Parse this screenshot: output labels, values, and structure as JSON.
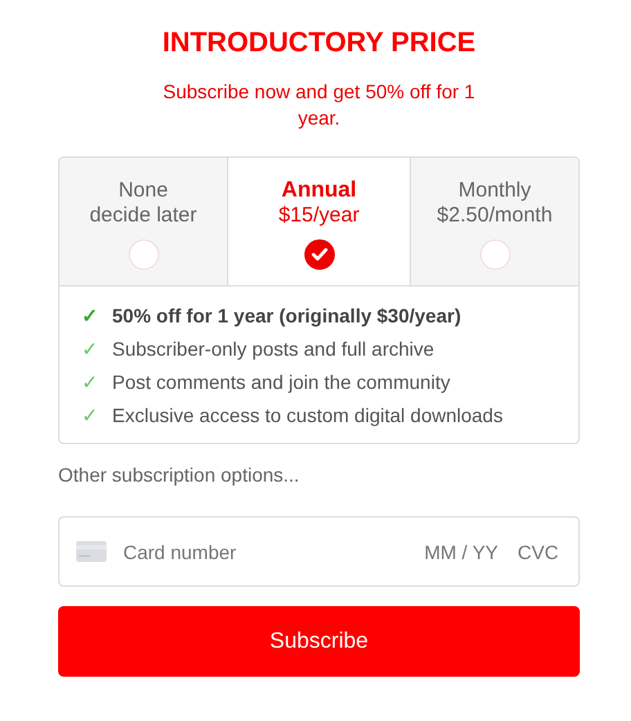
{
  "title": "INTRODUCTORY PRICE",
  "subtitle": "Subscribe now and get 50% off for 1 year.",
  "plans": [
    {
      "name": "None",
      "price": "decide later",
      "selected": false
    },
    {
      "name": "Annual",
      "price": "$15/year",
      "selected": true
    },
    {
      "name": "Monthly",
      "price": "$2.50/month",
      "selected": false
    }
  ],
  "features": [
    {
      "mark": "✓",
      "text": "50% off for 1 year (originally $30/year)",
      "emphasis": true
    },
    {
      "mark": "✓",
      "text": "Subscriber-only posts and full archive",
      "emphasis": false
    },
    {
      "mark": "✓",
      "text": "Post comments and join the community",
      "emphasis": false
    },
    {
      "mark": "✓",
      "text": "Exclusive access to custom digital downloads",
      "emphasis": false
    }
  ],
  "other_options_link": "Other subscription options...",
  "card_field": {
    "placeholder": "Card number",
    "expiry_placeholder": "MM / YY",
    "cvc_placeholder": "CVC"
  },
  "submit_button": "Subscribe"
}
